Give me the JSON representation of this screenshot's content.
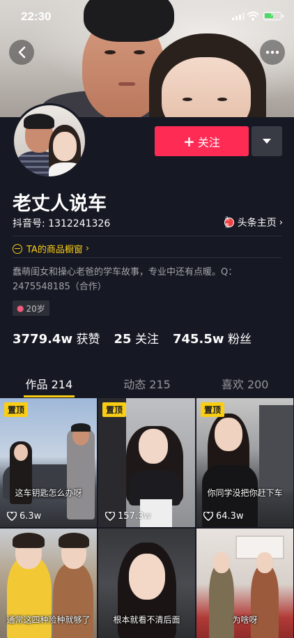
{
  "status_bar": {
    "time": "22:30"
  },
  "profile": {
    "name": "老丈人说车",
    "douyin_id": "抖音号: 1312241326",
    "toutiao_label": "头条主页",
    "toutiao_icon_text": "头条",
    "shop_label": "TA的商品橱窗",
    "bio": "蠢萌闺女和操心老爸的学车故事，专业中还有点暖。Q：2475548185（合作）",
    "age": "20岁"
  },
  "actions": {
    "follow_label": "关注",
    "follow_plus": "+"
  },
  "stats": [
    {
      "value": "3779.4w",
      "label": "获赞"
    },
    {
      "value": "25",
      "label": "关注"
    },
    {
      "value": "745.5w",
      "label": "粉丝"
    }
  ],
  "tabs": [
    {
      "label": "作品 214",
      "active": true
    },
    {
      "label": "动态 215",
      "active": false
    },
    {
      "label": "喜欢 200",
      "active": false
    }
  ],
  "videos": [
    {
      "pinned": "置顶",
      "caption": "这车钥匙怎么办呀",
      "likes": "6.3w"
    },
    {
      "pinned": "置顶",
      "caption": "",
      "likes": "157.3w"
    },
    {
      "pinned": "置顶",
      "caption": "你同学没把你赶下车",
      "likes": "64.3w"
    },
    {
      "pinned": "",
      "caption": "通常这四种险种就够了",
      "likes": ""
    },
    {
      "pinned": "",
      "caption": "根本就看不清后面",
      "likes": ""
    },
    {
      "pinned": "",
      "caption": "为啥呀",
      "likes": ""
    }
  ],
  "colors": {
    "accent": "#fe2c55",
    "highlight": "#face15",
    "background": "#161823"
  }
}
